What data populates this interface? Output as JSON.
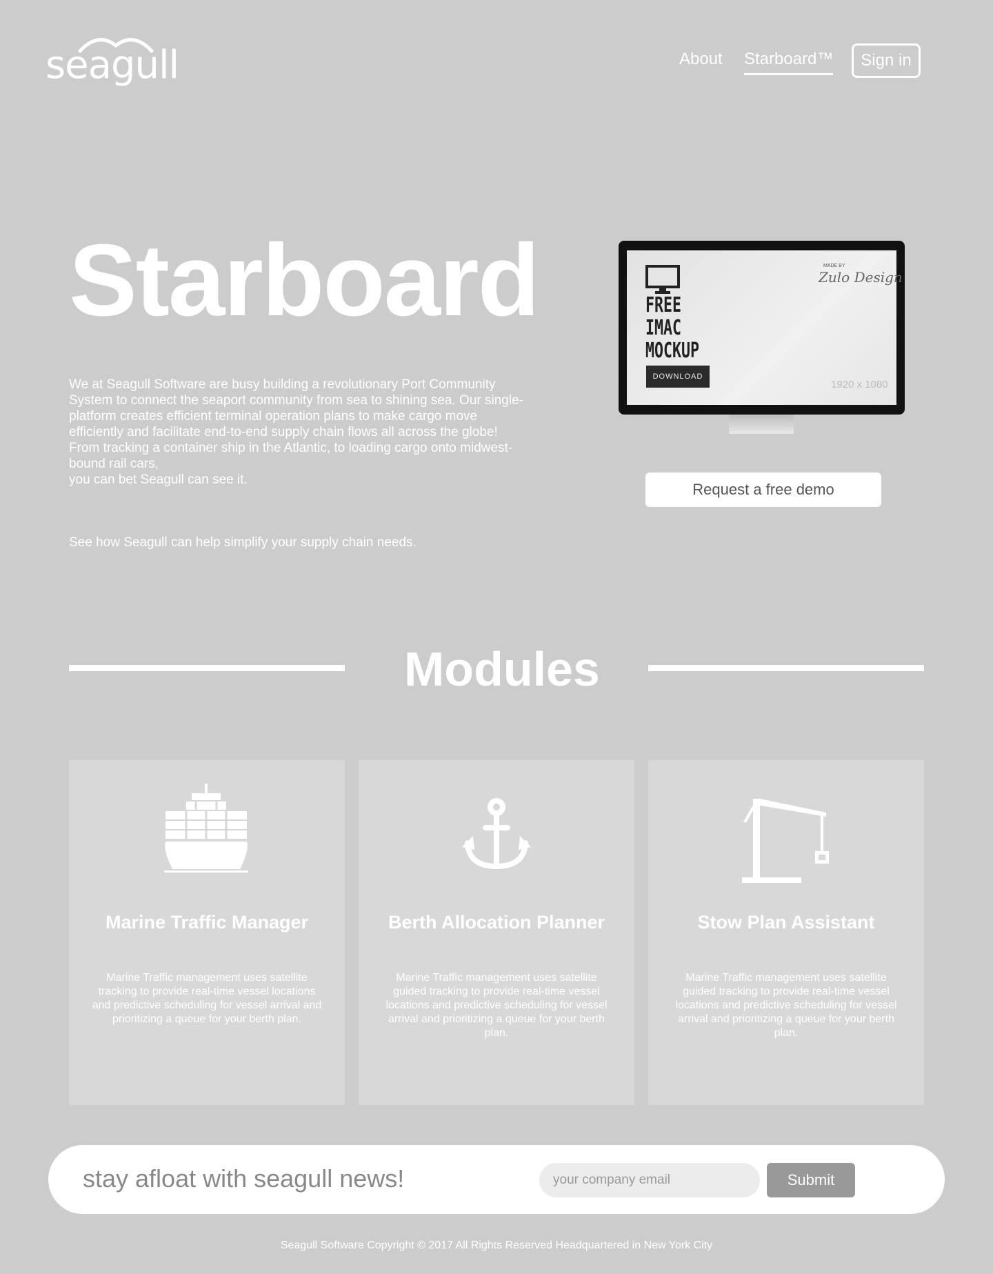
{
  "header": {
    "logo_text": "seagull",
    "nav": {
      "about": "About",
      "starboard": "Starboard™",
      "signin": "Sign in"
    }
  },
  "hero": {
    "title": "Starboard",
    "description": [
      "We at Seagull Software are busy building a revolutionary Port Community System to connect the seaport community from sea to shining sea. Our single-platform creates efficient terminal operation plans to make cargo move efficiently and facilitate end-to-end supply chain flows all across the globe! From tracking a container ship in the Atlantic, to loading cargo onto midwest-bound rail cars,",
      "you can bet Seagull can see it."
    ],
    "cta_text": "See how Seagull can help  simplify your supply chain needs.",
    "mockup": {
      "title_lines": [
        "FREE",
        "IMAC",
        "MOCKUP"
      ],
      "download": "DOWNLOAD",
      "made_by": "MADE BY",
      "signature": "Zulo Design",
      "resolution": "1920 x 1080"
    },
    "demo_button": "Request  a  free demo"
  },
  "modules": {
    "heading": "Modules",
    "cards": [
      {
        "title": "Marine Traffic Manager",
        "description": "Marine Traffic management uses satellite tracking to provide real-time vessel locations and predictive scheduling for vessel arrival and prioritizing a queue for your berth plan.",
        "icon": "cargo-ship-icon"
      },
      {
        "title": "Berth Allocation Planner",
        "description": "Marine Traffic management uses satellite guided tracking to provide real-time vessel locations and predictive scheduling for vessel arrival and prioritizing a queue for your berth plan.",
        "icon": "anchor-icon"
      },
      {
        "title": "Stow Plan Assistant",
        "description": "Marine Traffic management uses satellite guided tracking to provide real-time vessel locations and predictive scheduling for vessel arrival and prioritizing a queue for your berth plan.",
        "icon": "crane-icon"
      }
    ]
  },
  "newsletter": {
    "title": "stay afloat with seagull news!",
    "email_placeholder": "your company email",
    "submit": "Submit"
  },
  "footer": {
    "text": "Seagull Software  Copyright © 2017 All Rights Reserved  Headquartered in New York City"
  },
  "colors": {
    "background": "#cccccc",
    "card": "#d8d8d8",
    "text": "#ffffff",
    "submit": "#999999"
  }
}
